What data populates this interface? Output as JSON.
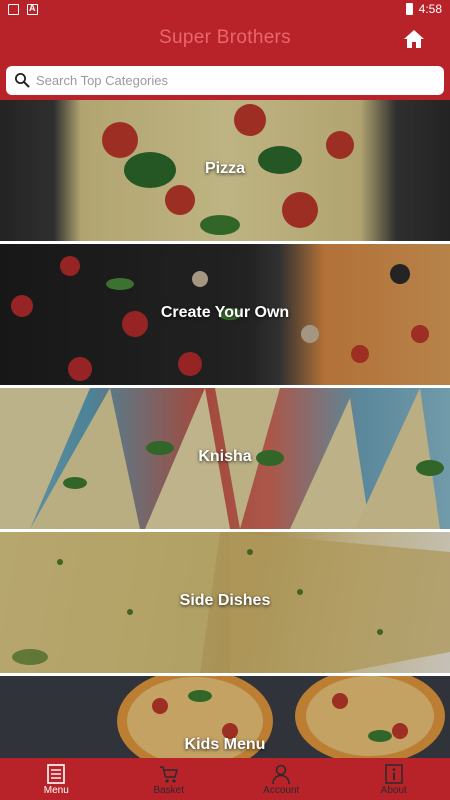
{
  "status_bar": {
    "time": "4:58"
  },
  "app_bar": {
    "title": "Super Brothers"
  },
  "search": {
    "placeholder": "Search Top Categories",
    "value": ""
  },
  "categories": [
    {
      "label": "Pizza"
    },
    {
      "label": "Create Your Own"
    },
    {
      "label": "Knisha"
    },
    {
      "label": "Side Dishes"
    },
    {
      "label": "Kids Menu"
    }
  ],
  "bottom_nav": {
    "items": [
      {
        "label": "Menu",
        "icon": "menu-book-icon",
        "active": true
      },
      {
        "label": "Basket",
        "icon": "basket-icon",
        "active": false
      },
      {
        "label": "Account",
        "icon": "account-icon",
        "active": false
      },
      {
        "label": "About",
        "icon": "info-icon",
        "active": false
      }
    ]
  },
  "colors": {
    "brand": "#b8232a",
    "title_text": "#e9666c"
  }
}
